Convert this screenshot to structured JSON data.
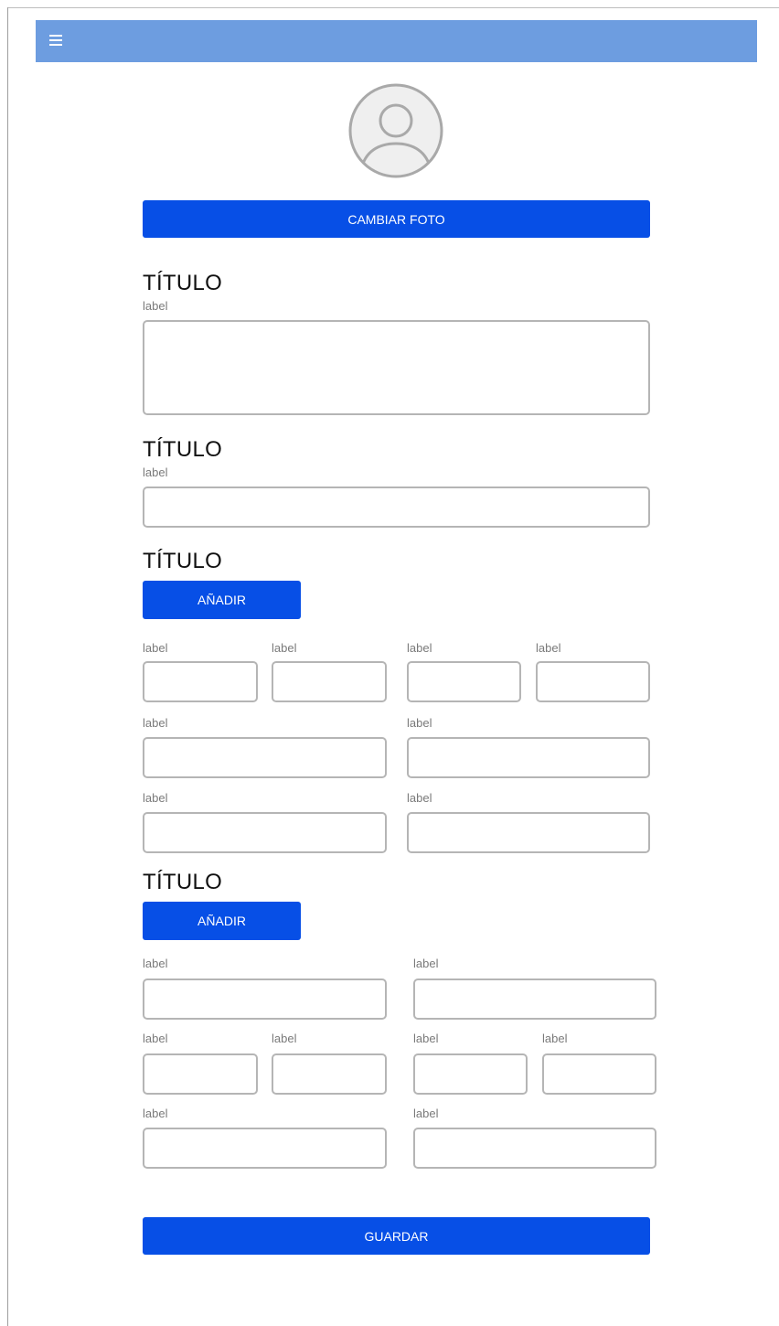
{
  "header": {
    "menu_icon": "hamburger-menu-icon",
    "background": "#6d9de0"
  },
  "profile": {
    "avatar_icon": "user-avatar-icon",
    "change_photo_label": "CAMBIAR FOTO"
  },
  "section1": {
    "title": "TÍTULO",
    "label": "label",
    "value": ""
  },
  "section2": {
    "title": "TÍTULO",
    "label": "label",
    "value": ""
  },
  "section3": {
    "title": "TÍTULO",
    "add_label": "AÑADIR",
    "row1": {
      "labels": [
        "label",
        "label",
        "label",
        "label"
      ]
    },
    "row2": {
      "labels": [
        "label",
        "label"
      ]
    },
    "row3": {
      "labels": [
        "label",
        "label"
      ]
    }
  },
  "section4": {
    "title": "TÍTULO",
    "add_label": "AÑADIR",
    "row1": {
      "labels": [
        "label",
        "label"
      ]
    },
    "row2": {
      "labels": [
        "label",
        "label",
        "label",
        "label"
      ]
    },
    "row3": {
      "labels": [
        "label",
        "label"
      ]
    }
  },
  "footer": {
    "save_label": "GUARDAR"
  },
  "colors": {
    "primary_button": "#074fe6",
    "field_border": "#b5b5b5"
  }
}
